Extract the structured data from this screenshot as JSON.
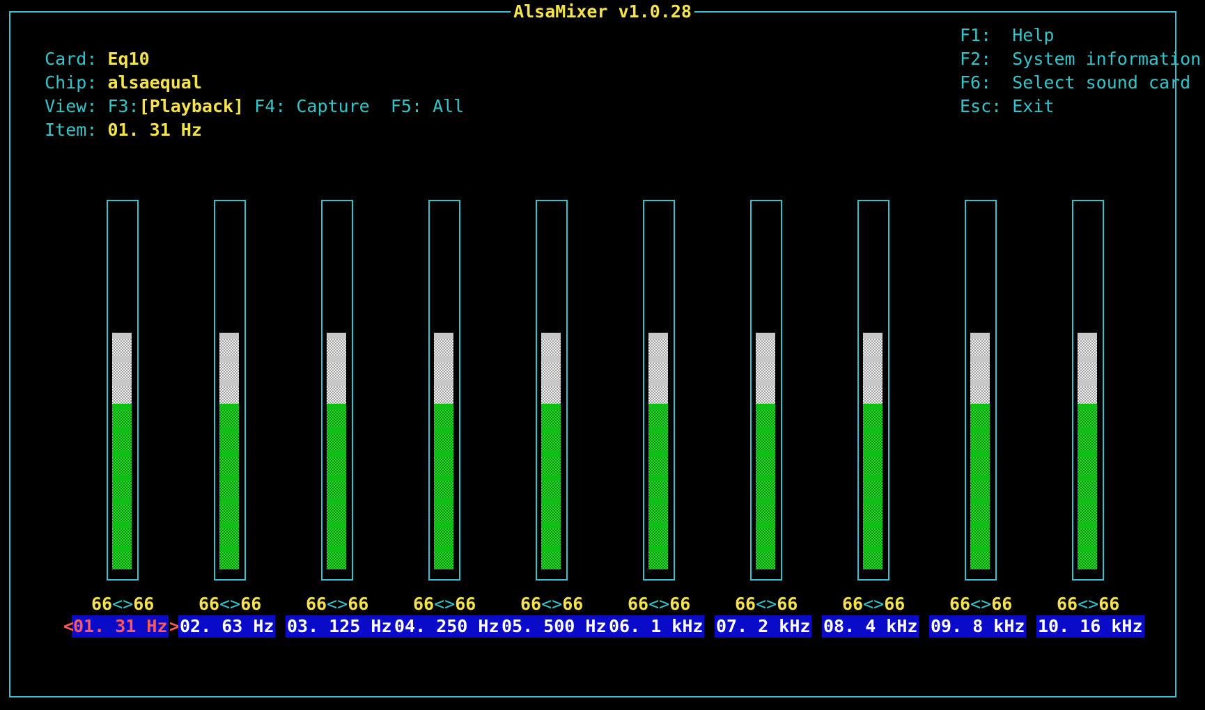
{
  "title": "AlsaMixer v1.0.28",
  "info": {
    "card_label": "Card:",
    "card_value": "Eq10",
    "chip_label": "Chip:",
    "chip_value": "alsaequal",
    "view_label": "View:",
    "view_f3": "F3:",
    "view_playback": "[Playback]",
    "view_capture": "F4: Capture",
    "view_all": "F5: All",
    "item_label": "Item:",
    "item_value": "01. 31 Hz"
  },
  "help": {
    "f1": "F1:  Help",
    "f2": "F2:  System information",
    "f6": "F6:  Select sound card",
    "esc": "Esc: Exit"
  },
  "colors": {
    "frame": "#35c4c9",
    "highlight": "#f4e34e",
    "level_fill": "#10bf15",
    "level_top": "#d8d8d8",
    "label_bg": "#0a0ac9",
    "selected_text": "#ff5a5a"
  },
  "controls": [
    {
      "name": "01. 31 Hz",
      "left": "66",
      "right": "66",
      "level_percent": 66,
      "selected": true
    },
    {
      "name": "02. 63 Hz",
      "left": "66",
      "right": "66",
      "level_percent": 66,
      "selected": false
    },
    {
      "name": "03. 125 Hz",
      "left": "66",
      "right": "66",
      "level_percent": 66,
      "selected": false
    },
    {
      "name": "04. 250 Hz",
      "left": "66",
      "right": "66",
      "level_percent": 66,
      "selected": false
    },
    {
      "name": "05. 500 Hz",
      "left": "66",
      "right": "66",
      "level_percent": 66,
      "selected": false
    },
    {
      "name": "06. 1 kHz",
      "left": "66",
      "right": "66",
      "level_percent": 66,
      "selected": false
    },
    {
      "name": "07. 2 kHz",
      "left": "66",
      "right": "66",
      "level_percent": 66,
      "selected": false
    },
    {
      "name": "08. 4 kHz",
      "left": "66",
      "right": "66",
      "level_percent": 66,
      "selected": false
    },
    {
      "name": "09. 8 kHz",
      "left": "66",
      "right": "66",
      "level_percent": 66,
      "selected": false
    },
    {
      "name": "10. 16 kHz",
      "left": "66",
      "right": "66",
      "level_percent": 66,
      "selected": false
    }
  ],
  "value_separator": "<>",
  "selection_markers": {
    "left": "<",
    "right": ">"
  }
}
